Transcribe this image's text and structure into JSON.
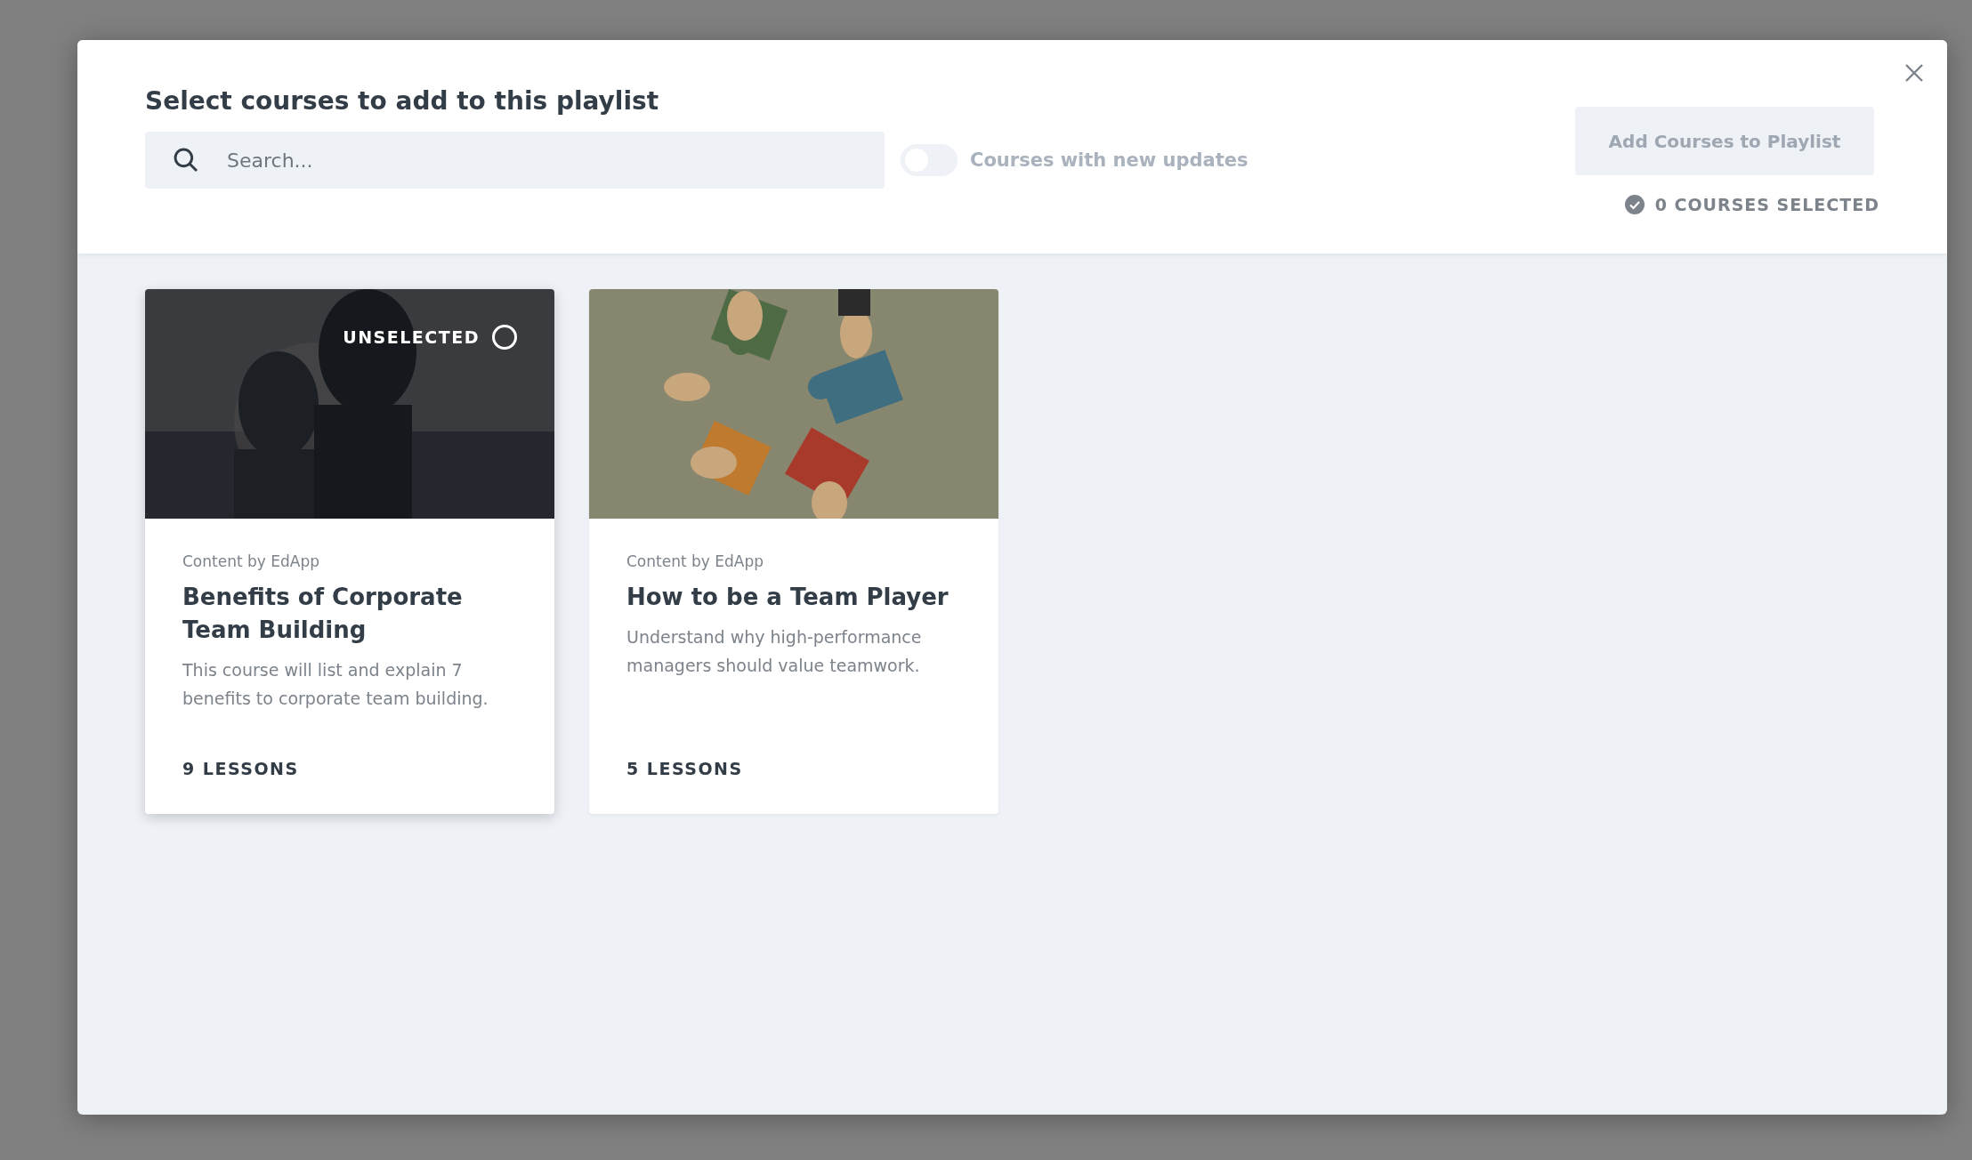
{
  "modal": {
    "title": "Select courses to add to this playlist",
    "search": {
      "placeholder": "Search..."
    },
    "filter_toggle": {
      "label": "Courses with new updates",
      "on": false
    },
    "add_button": {
      "label": "Add Courses to Playlist",
      "disabled": true
    },
    "selected_count": "0 COURSES SELECTED",
    "courses": [
      {
        "kind": "people",
        "source": "Content by EdApp",
        "title": "Benefits of Corporate Team Building",
        "description": "This course will list and explain 7 benefits to corporate team building.",
        "lessons": "9 LESSONS",
        "hovered": true,
        "selection": {
          "label": "UNSELECTED",
          "selected": false
        }
      },
      {
        "kind": "puzzle",
        "source": "Content by EdApp",
        "title": "How to be a Team Player",
        "description": "Understand why high-performance managers should value teamwork.",
        "lessons": "5 LESSONS",
        "hovered": false
      }
    ]
  }
}
